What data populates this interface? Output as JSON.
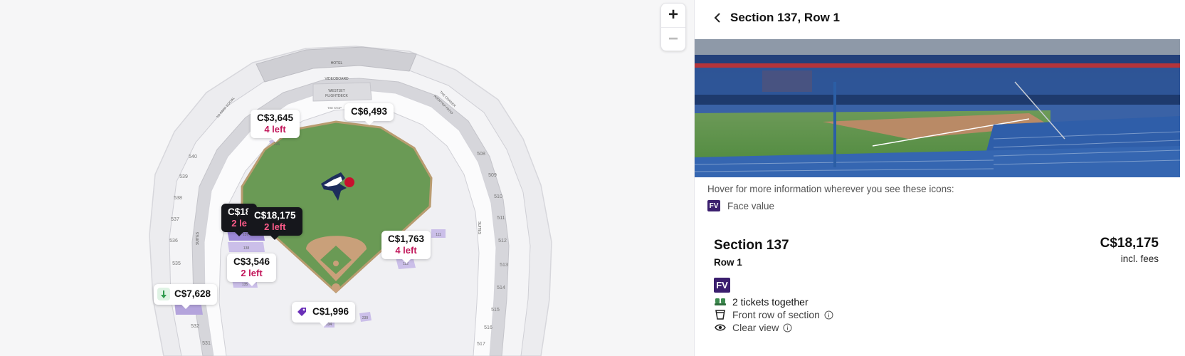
{
  "map": {
    "zoom_in_label": "+",
    "zoom_out_label": "−",
    "venue_labels": {
      "hotel": "HOTEL",
      "videoboard": "VIDEOBOARD",
      "westjet": "WESTJET",
      "flightdeck": "FLIGHTDECK",
      "the_stop": "THE STOP",
      "suites_left": "SUITES",
      "suites_right": "SUITES",
      "to_park_social": "TO PARK SOCIAL",
      "the_corner": "THE CORNER",
      "rooftop_patio": "ROOFTOP PATIO"
    },
    "section_numbers_left": [
      "540",
      "539",
      "538",
      "537",
      "536",
      "535",
      "533",
      "532",
      "531"
    ],
    "section_numbers_right": [
      "508",
      "509",
      "510",
      "511",
      "512",
      "513",
      "514",
      "515",
      "516",
      "517"
    ],
    "section_numbers_inner": [
      "137",
      "138",
      "135",
      "111",
      "112",
      "226",
      "134",
      "239"
    ],
    "pins": [
      {
        "price": "C$3,645",
        "left": "4 left"
      },
      {
        "price": "C$6,493",
        "left": ""
      },
      {
        "price": "C$18,175",
        "left": "2 left"
      },
      {
        "price": "C$18,175",
        "left": "2 left"
      },
      {
        "price": "C$1,763",
        "left": "4 left"
      },
      {
        "price": "C$3,546",
        "left": "2 left"
      },
      {
        "price": "C$7,628",
        "left": ""
      },
      {
        "price": "C$1,996",
        "left": ""
      }
    ],
    "partial_pin": {
      "price": "C$18",
      "left": "2 le"
    }
  },
  "panel": {
    "title": "Section 137, Row 1",
    "hover_info": "Hover for more information wherever you see these icons:",
    "fv_badge": "FV",
    "fv_label": "Face value",
    "section": "Section 137",
    "row": "Row 1",
    "price": "C$18,175",
    "incl_fees": "incl. fees",
    "fv_big": "FV",
    "features": [
      {
        "label": "2 tickets together",
        "icon": "seats-icon"
      },
      {
        "label": "Front row of section",
        "icon": "front-row-icon"
      },
      {
        "label": "Clear view",
        "icon": "eye-icon"
      }
    ]
  },
  "colors": {
    "field": "#6a9a55",
    "infield": "#c9a07a",
    "available_section": "#b4a4dc",
    "brand_purple": "#3b1f6e",
    "left_pink": "#c2185b"
  }
}
